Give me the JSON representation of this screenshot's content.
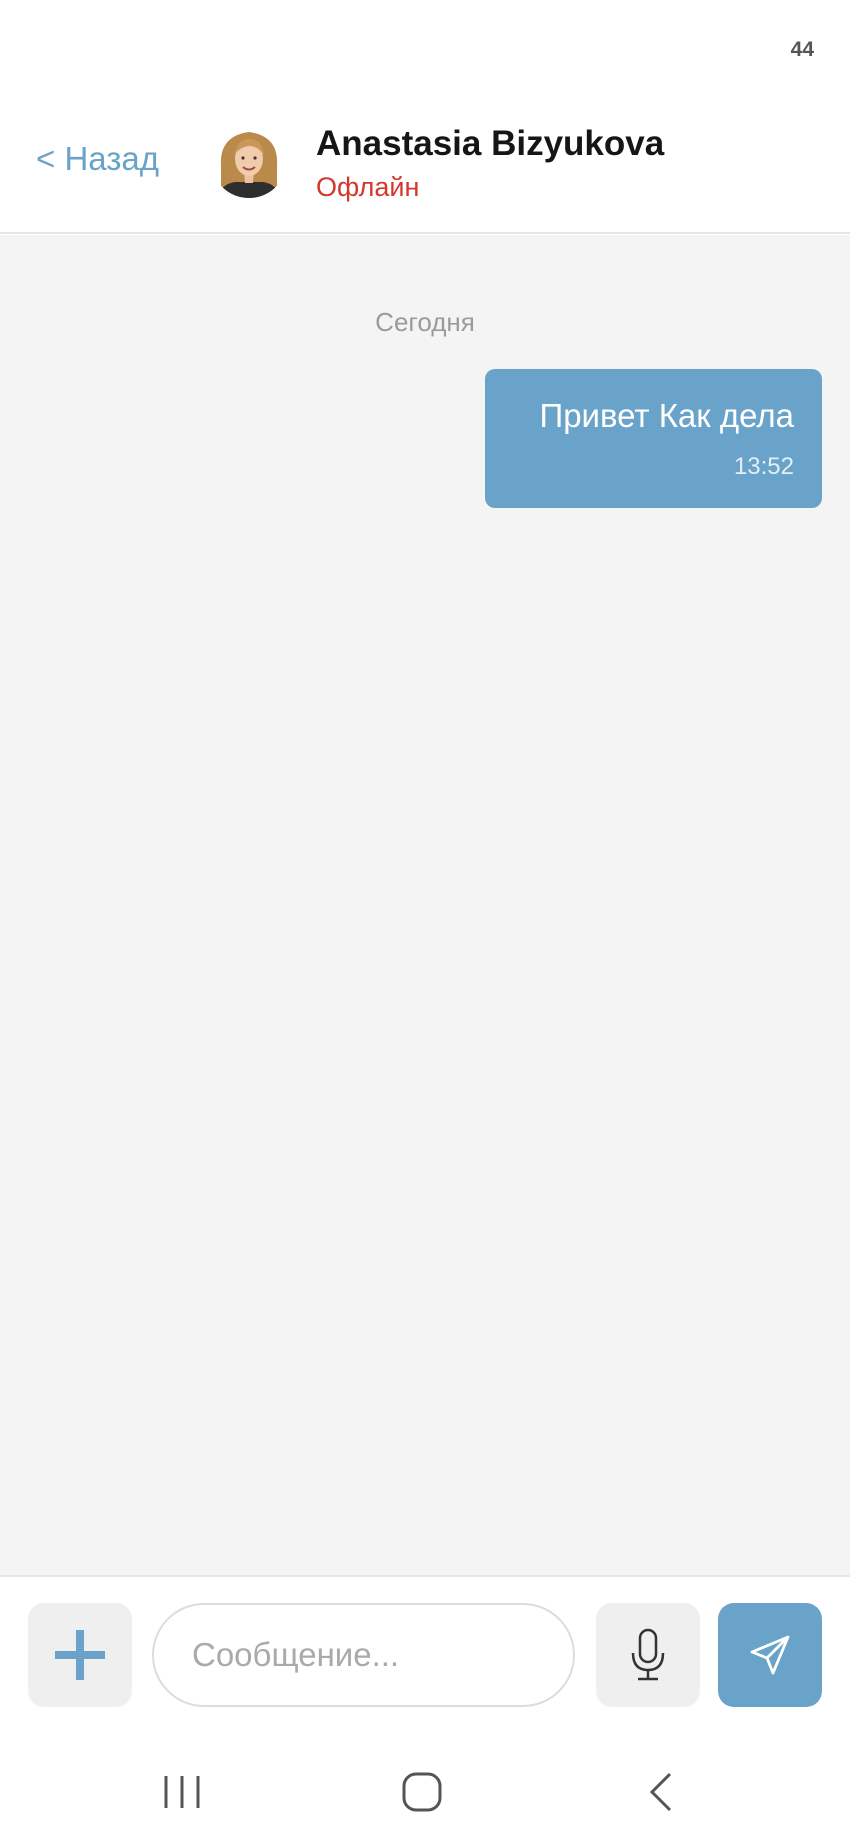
{
  "status_bar": {
    "number": "44"
  },
  "header": {
    "back_label": "< Назад",
    "contact_name": "Anastasia Bizyukova",
    "contact_status": "Офлайн",
    "avatar_icon": "user-avatar-photo"
  },
  "chat": {
    "date_separator": "Сегодня",
    "messages": [
      {
        "text": "Привет Как дела",
        "time": "13:52",
        "direction": "outgoing"
      }
    ]
  },
  "input_bar": {
    "add_icon": "plus-icon",
    "placeholder": "Сообщение...",
    "value": "",
    "mic_icon": "microphone-icon",
    "send_icon": "paper-plane-icon"
  },
  "nav_bar": {
    "icons": [
      "recent-apps-icon",
      "home-icon",
      "back-arrow-icon"
    ]
  },
  "colors": {
    "accent": "#6aa3c9",
    "offline_status": "#d2382b",
    "chat_background": "#f4f4f4",
    "button_background": "#efefef"
  }
}
